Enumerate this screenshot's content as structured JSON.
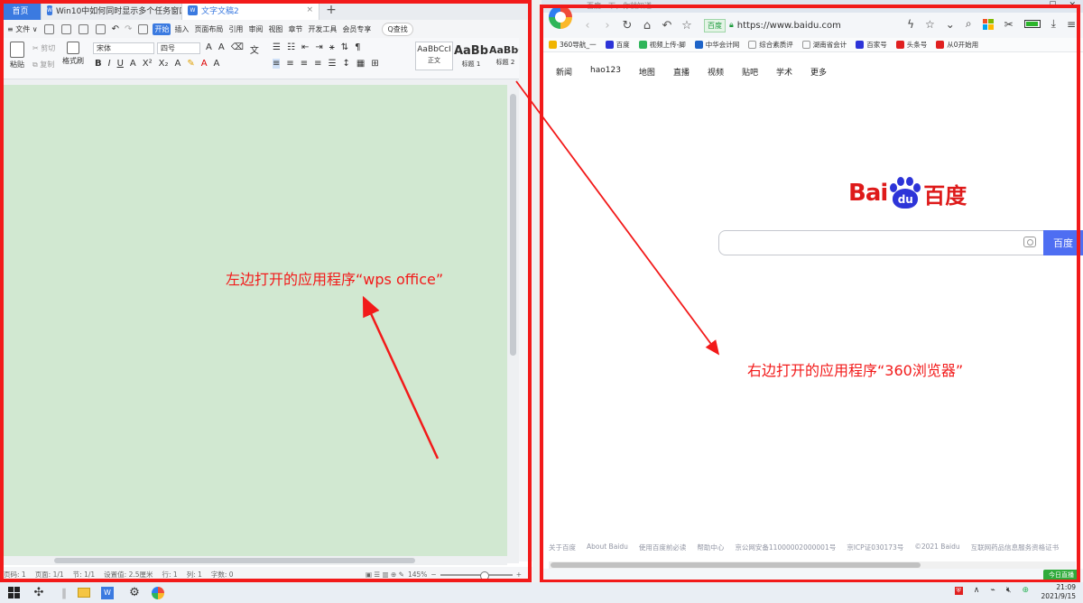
{
  "wps": {
    "tabs": [
      {
        "label": "首页"
      },
      {
        "label": "Win10中如何同时显示多个任务窗口",
        "badge": "W"
      },
      {
        "label": "文字文稿2",
        "badge": "W"
      }
    ],
    "menu": {
      "file": "≡ 文件 ∨",
      "items": [
        "开始",
        "插入",
        "页面布局",
        "引用",
        "审阅",
        "视图",
        "章节",
        "开发工具",
        "会员专享"
      ],
      "search": "Q查找"
    },
    "ribbon": {
      "paste": "粘贴",
      "cut": "剪切",
      "copy": "复制",
      "format_painter": "格式刷",
      "font_name": "宋体",
      "font_size": "四号",
      "styles": [
        {
          "sample": "AaBbCcI",
          "label": "正文"
        },
        {
          "sample": "AaBb",
          "label": "标题 1"
        },
        {
          "sample": "AaBbC",
          "label": "标题 2"
        }
      ]
    },
    "status": {
      "page": "页码: 1",
      "pages": "页面: 1/1",
      "section": "节: 1/1",
      "setting": "设置值: 2.5厘米",
      "row": "行: 1",
      "col": "列: 1",
      "words": "字数: 0",
      "zoom": "145%"
    }
  },
  "browser": {
    "tab_title": "百度一下，你就知道",
    "url_badge": "百度",
    "url": "https://www.baidu.com",
    "bookmarks": [
      "360导航_一",
      "百度",
      "视频上传-脚",
      "中华会计网",
      "综合素质评",
      "湖南省会计",
      "百家号",
      "头条号",
      "从0开始用"
    ],
    "nav": [
      "新闻",
      "hao123",
      "地图",
      "直播",
      "视频",
      "贴吧",
      "学术",
      "更多"
    ],
    "logo_left": "Bai",
    "logo_paw": "du",
    "logo_right": "百度",
    "search_button": "百度",
    "footer": [
      "关于百度",
      "About Baidu",
      "使用百度前必读",
      "帮助中心",
      "京公网安备11000002000001号",
      "京ICP证030173号",
      "©2021 Baidu",
      "互联网药品信息服务资格证书"
    ],
    "status_badge": "今日直播"
  },
  "annotations": {
    "left_note": "左边打开的应用程序“wps office”",
    "right_note": "右边打开的应用程序“360浏览器”",
    "color": "#f21a1a"
  },
  "taskbar": {
    "time": "21:09",
    "date": "2021/9/15"
  }
}
